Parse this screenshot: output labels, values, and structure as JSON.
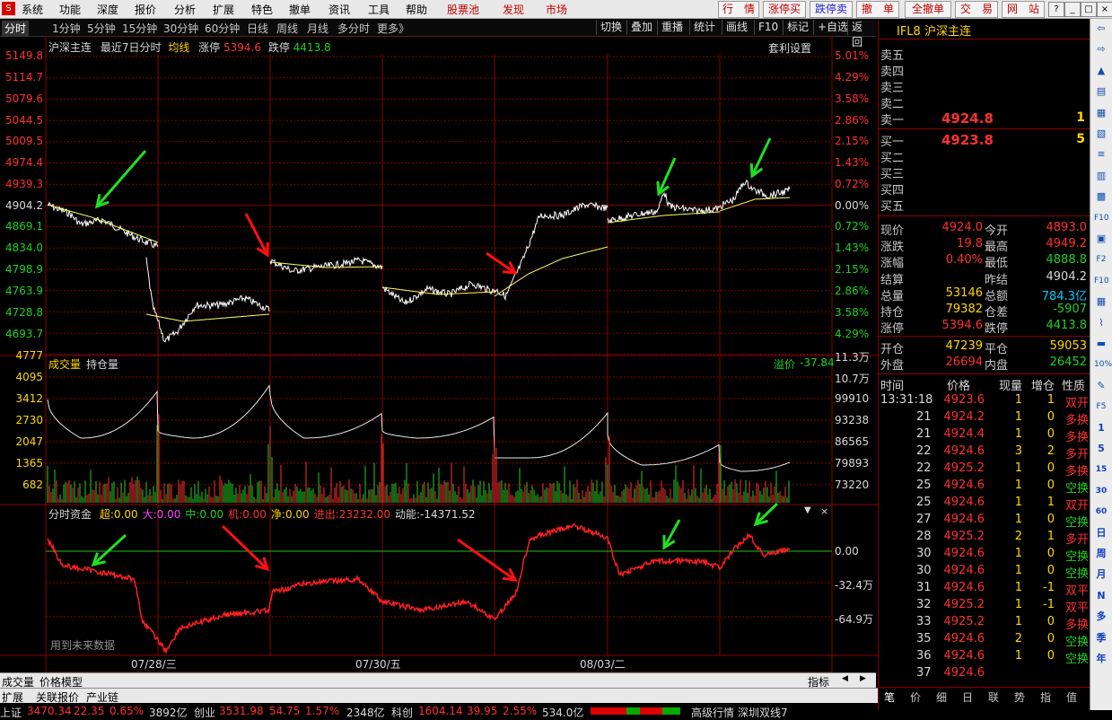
{
  "menubar": {
    "items": [
      "系统",
      "功能",
      "深度",
      "报价",
      "分析",
      "扩展",
      "特色",
      "撤单",
      "资讯",
      "工具",
      "帮助"
    ],
    "highlight": [
      "股票池",
      "发现",
      "市场"
    ],
    "right_buttons": [
      "行　情",
      "涨停买",
      "跌停卖",
      "撤　单",
      "全撤单",
      "交　易",
      "网　站"
    ],
    "window_buttons": [
      "?",
      "_",
      "□",
      "×"
    ]
  },
  "toolbar": {
    "periods": [
      "分时",
      "1分钟",
      "5分钟",
      "15分钟",
      "30分钟",
      "60分钟",
      "日线",
      "周线",
      "月线",
      "多分时",
      "更多》"
    ],
    "right": [
      "切换",
      "叠加",
      "重播",
      "统计",
      "画线",
      "F10",
      "标记",
      "+自选",
      "返回"
    ]
  },
  "chart_header": {
    "name": "沪深主连",
    "range": "最近7日分时",
    "avg_label": "均线",
    "limit_up_label": "涨停",
    "limit_up": "5394.6",
    "limit_down_label": "跌停",
    "limit_down": "4413.8",
    "arb_label": "套利设置"
  },
  "price_axis": {
    "left": [
      "5149.8",
      "5114.7",
      "5079.6",
      "5044.5",
      "5009.5",
      "4974.4",
      "4939.3",
      "4904.2",
      "4869.1",
      "4834.0",
      "4798.9",
      "4763.9",
      "4728.8",
      "4693.7",
      "4777"
    ],
    "right": [
      "5.01%",
      "4.29%",
      "3.58%",
      "2.86%",
      "2.15%",
      "1.43%",
      "0.72%",
      "0.00%",
      "0.72%",
      "1.43%",
      "2.15%",
      "2.86%",
      "3.58%",
      "4.29%",
      "11.3万"
    ]
  },
  "volume_panel": {
    "label_vol": "成交量",
    "label_oi": "持仓量",
    "premium_label": "溢价",
    "premium": "-37.84",
    "left": [
      "4095",
      "3412",
      "2730",
      "2047",
      "1365",
      "682"
    ],
    "right": [
      "10.7万",
      "99910",
      "93238",
      "86565",
      "79893",
      "73220"
    ]
  },
  "fund_panel": {
    "title": "分时资金",
    "items": [
      {
        "label": "超:",
        "value": "0.00",
        "color": "#ffd700"
      },
      {
        "label": "大:",
        "value": "0.00",
        "color": "#ff40ff"
      },
      {
        "label": "中:",
        "value": "0.00",
        "color": "#20d020"
      },
      {
        "label": "机:",
        "value": "0.00",
        "color": "#ff3030"
      },
      {
        "label": "净:",
        "value": "0.00",
        "color": "#ffd700"
      },
      {
        "label": "进出:",
        "value": "23232.00",
        "color": "#ff3030"
      },
      {
        "label": "动能:",
        "value": "-14371.52",
        "color": "#d8d8d8"
      }
    ],
    "axis_right": [
      "0.00",
      "-32.4万",
      "-64.9万"
    ],
    "future_note": "用到未来数据"
  },
  "date_axis": [
    "07/28/三",
    "07/30/五",
    "08/03/二"
  ],
  "bottom_tabs": [
    "成交量",
    "价格模型"
  ],
  "bottom_tabs_right": [
    "指标"
  ],
  "bottom2": [
    "扩展",
    "关联报价",
    "产业链"
  ],
  "status": {
    "items": [
      {
        "name": "上证",
        "price": "3470.34",
        "chg": "22.35",
        "pct": "0.65%",
        "amt": "3892亿"
      },
      {
        "name": "创业",
        "price": "3531.98",
        "chg": "54.75",
        "pct": "1.57%",
        "amt": "2348亿"
      },
      {
        "name": "科创",
        "price": "1604.14",
        "chg": "39.95",
        "pct": "2.55%",
        "amt": "534.0亿"
      }
    ],
    "right": [
      "高级行情",
      "深圳双线7"
    ]
  },
  "quote": {
    "title": "IFL8 沪深主连",
    "ask": [
      {
        "label": "卖五",
        "price": "",
        "vol": ""
      },
      {
        "label": "卖四",
        "price": "",
        "vol": ""
      },
      {
        "label": "卖三",
        "price": "",
        "vol": ""
      },
      {
        "label": "卖二",
        "price": "",
        "vol": ""
      },
      {
        "label": "卖一",
        "price": "4924.8",
        "vol": "1"
      }
    ],
    "bid": [
      {
        "label": "买一",
        "price": "4923.8",
        "vol": "5"
      },
      {
        "label": "买二",
        "price": "",
        "vol": ""
      },
      {
        "label": "买三",
        "price": "",
        "vol": ""
      },
      {
        "label": "买四",
        "price": "",
        "vol": ""
      },
      {
        "label": "买五",
        "price": "",
        "vol": ""
      }
    ],
    "stats": [
      [
        "现价",
        "4924.0",
        "今开",
        "4893.0"
      ],
      [
        "涨跌",
        "19.8",
        "最高",
        "4949.2"
      ],
      [
        "涨幅",
        "0.40%",
        "最低",
        "4888.8"
      ],
      [
        "结算",
        "",
        "昨结",
        "4904.2"
      ],
      [
        "总量",
        "53146",
        "总额",
        "784.3亿"
      ],
      [
        "持仓",
        "79382",
        "仓差",
        "-5907"
      ],
      [
        "涨停",
        "5394.6",
        "跌停",
        "4413.8"
      ]
    ],
    "stats2": [
      [
        "开仓",
        "47239",
        "平仓",
        "59053"
      ],
      [
        "外盘",
        "26694",
        "内盘",
        "26452"
      ]
    ],
    "ticks_header": [
      "时间",
      "价格",
      "现量",
      "增仓",
      "性质"
    ],
    "ticks": [
      [
        "13:31:18",
        "4923.6",
        "1",
        "1",
        "双开"
      ],
      [
        "21",
        "4924.2",
        "1",
        "0",
        "多换"
      ],
      [
        "21",
        "4924.4",
        "1",
        "0",
        "多换"
      ],
      [
        "22",
        "4924.6",
        "3",
        "2",
        "多开"
      ],
      [
        "22",
        "4925.2",
        "1",
        "0",
        "多换"
      ],
      [
        "25",
        "4924.6",
        "1",
        "0",
        "空换"
      ],
      [
        "25",
        "4924.6",
        "1",
        "1",
        "双开"
      ],
      [
        "27",
        "4924.6",
        "1",
        "0",
        "空换"
      ],
      [
        "28",
        "4925.2",
        "2",
        "1",
        "多开"
      ],
      [
        "30",
        "4924.6",
        "1",
        "0",
        "空换"
      ],
      [
        "30",
        "4924.6",
        "1",
        "0",
        "空换"
      ],
      [
        "31",
        "4924.6",
        "1",
        "-1",
        "双平"
      ],
      [
        "32",
        "4925.2",
        "1",
        "-1",
        "双平"
      ],
      [
        "33",
        "4925.2",
        "1",
        "0",
        "多换"
      ],
      [
        "35",
        "4924.6",
        "2",
        "0",
        "空换"
      ],
      [
        "36",
        "4924.6",
        "1",
        "0",
        "空换"
      ],
      [
        "37",
        "4924.6",
        "",
        "",
        ""
      ]
    ],
    "bottom_tabs": [
      "笔",
      "价",
      "细",
      "日",
      "联",
      "势",
      "指",
      "值"
    ]
  },
  "iconbar": [
    "⇦",
    "⇨",
    "▲",
    "▤",
    "▦",
    "▧",
    "≡",
    "▥",
    "▩",
    "F10",
    "▣",
    "F2",
    "F10",
    "▦",
    "⌇",
    "▬",
    "10%",
    "✎",
    "F5",
    "1",
    "5",
    "15",
    "30",
    "60",
    "日",
    "周",
    "月",
    "N",
    "多",
    "季",
    "年"
  ],
  "colors": {
    "up": "#ff3030",
    "down": "#20d020",
    "grid": "#8b0000",
    "price": "#ffffff",
    "avg": "#ffff60"
  }
}
